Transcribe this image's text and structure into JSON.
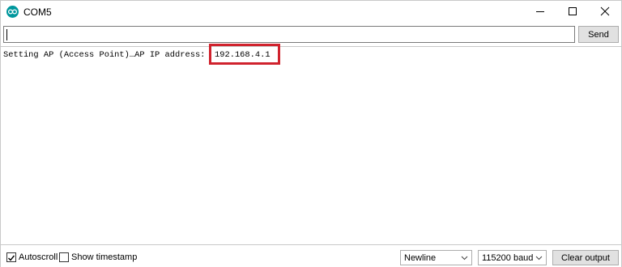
{
  "window": {
    "title": "COM5",
    "accent_color": "#00979d"
  },
  "input_row": {
    "input_value": "",
    "send_label": "Send"
  },
  "output": {
    "line_prefix": "Setting AP (Access Point)…AP IP address: ",
    "ip_address": "192.168.4.1",
    "highlight_color": "#d0222d"
  },
  "bottom_bar": {
    "autoscroll_label": "Autoscroll",
    "autoscroll_checked": true,
    "timestamp_label": "Show timestamp",
    "timestamp_checked": false,
    "line_ending_selected": "Newline",
    "baud_selected": "115200 baud",
    "clear_label": "Clear output"
  },
  "icons": [
    "arduino-logo-icon",
    "minimize-icon",
    "maximize-icon",
    "close-icon",
    "chevron-down-icon",
    "checkmark-icon"
  ]
}
